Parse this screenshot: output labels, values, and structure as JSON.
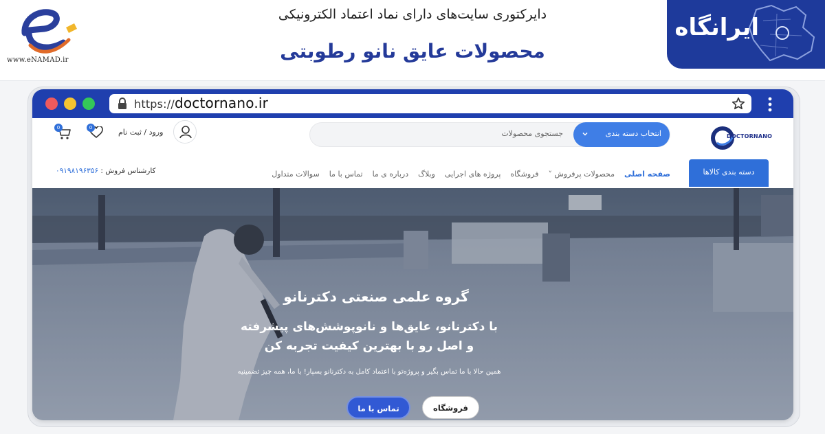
{
  "banner": {
    "enamad_url": "www.eNAMAD.ir",
    "subtitle": "دایرکتوری سایت‌های دارای نماد اعتماد الکترونیکی",
    "title": "محصولات عایق نانو رطوبتی",
    "brand": "ایرانگاه"
  },
  "browser": {
    "url_protocol": "https://",
    "url_domain": "doctornano.ir"
  },
  "site": {
    "logo": "DOCTORNANO",
    "search_placeholder": "جستجوی محصولات",
    "category_select": "انتخاب دسته بندی",
    "login": "ورود / ثبت نام",
    "wishlist_count": "0",
    "cart_count": "0"
  },
  "nav": {
    "categories_button": "دسته بندی کالاها",
    "items": [
      {
        "label": "صفحه اصلی"
      },
      {
        "label": "محصولات پرفروش ˅"
      },
      {
        "label": "فروشگاه"
      },
      {
        "label": "پروژه های اجرایی"
      },
      {
        "label": "وبلاگ"
      },
      {
        "label": "درباره ی ما"
      },
      {
        "label": "تماس با ما"
      },
      {
        "label": "سوالات متداول"
      }
    ],
    "sales_label": "کارشناس فروش :",
    "sales_phone": "۰۹۱۹۸۱۹۶۳۵۶"
  },
  "hero": {
    "title": "گروه علمی صنعتی دکترنانو",
    "line1": "با دکترنانو، عایق‌ها و نانوپوشش‌های پیشرفته",
    "line2": "و اصل رو با بهترین کیفیت تجربه کن",
    "small": "همین حالا با ما تماس بگیر و پروژه‌تو با اعتماد کامل به دکترنانو بسپار! با ما، همه چیز تضمینیه",
    "contact_button": "تماس با ما",
    "shop_button": "فروشگاه"
  },
  "colors": {
    "brand_blue": "#1f3fae",
    "accent_blue": "#2f6fd9",
    "title_blue": "#243a99"
  }
}
